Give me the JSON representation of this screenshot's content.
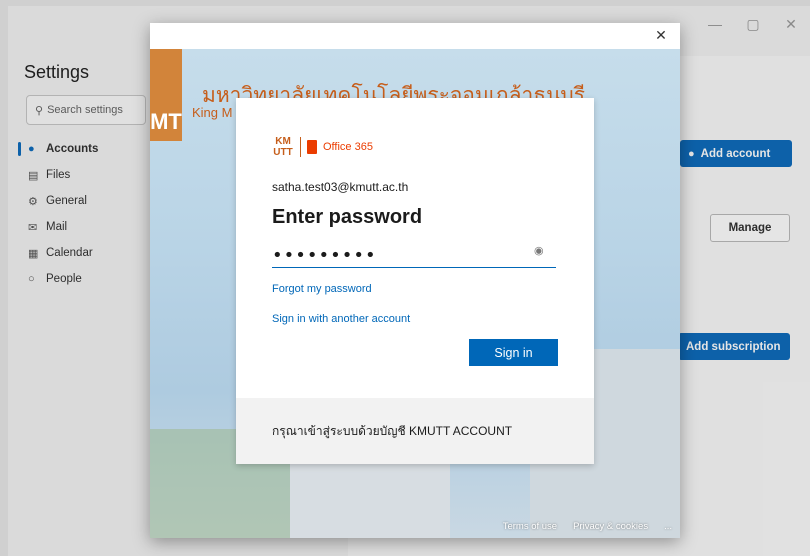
{
  "outlook": {
    "settings_title": "Settings",
    "search_placeholder": "Search settings",
    "nav_items": [
      {
        "label": "Accounts",
        "icon": "person-icon"
      },
      {
        "label": "Files",
        "icon": "file-icon"
      },
      {
        "label": "General",
        "icon": "gear-icon"
      },
      {
        "label": "Mail",
        "icon": "mail-icon"
      },
      {
        "label": "Calendar",
        "icon": "calendar-icon"
      },
      {
        "label": "People",
        "icon": "people-icon"
      }
    ],
    "add_account_label": "Add account",
    "manage_label": "Manage",
    "add_subscription_label": "Add subscription",
    "window_controls": {
      "minimize": "—",
      "maximize": "▢",
      "close": "✕"
    }
  },
  "signin_window": {
    "close_glyph": "✕",
    "university_thai": "มหาวิทยาลัยเทคโนโลยีพระจอมเกล้าธนบุรี",
    "university_en_partial": "King M",
    "logo_letters": "MT",
    "footer_links": [
      "Terms of use",
      "Privacy & cookies",
      "..."
    ]
  },
  "card": {
    "brand_km": "KM UTT",
    "brand_product": "Office 365",
    "email": "satha.test03@kmutt.ac.th",
    "heading": "Enter password",
    "password_masked": "•••••••••",
    "forgot_password": "Forgot my password",
    "another_account": "Sign in with another account",
    "sign_in_label": "Sign in",
    "footer_text": "กรุณาเข้าสู่ระบบด้วยบัญชี KMUTT ACCOUNT"
  },
  "colors": {
    "accent": "#0067b8",
    "outlook_blue": "#0f6cbd",
    "kmutt_orange": "#c65e1b"
  }
}
